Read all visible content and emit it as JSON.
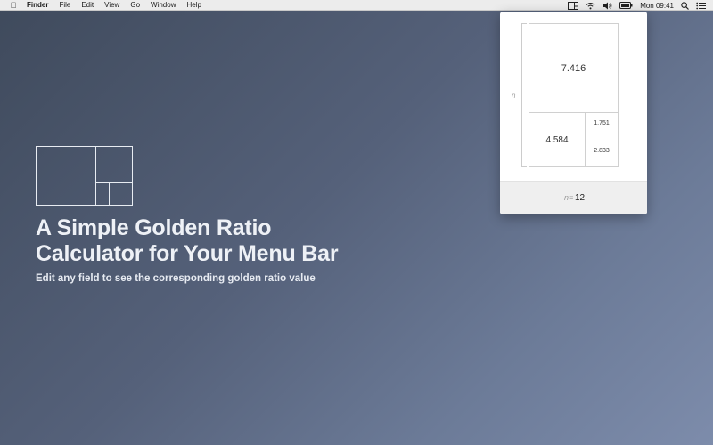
{
  "menubar": {
    "app_name": "Finder",
    "menus": [
      "File",
      "Edit",
      "View",
      "Go",
      "Window",
      "Help"
    ],
    "clock": "Mon 09:41",
    "status_icons": [
      "display-icon",
      "wifi-icon",
      "volume-icon",
      "battery-icon",
      "spotlight-icon",
      "notification-center-icon"
    ]
  },
  "hero": {
    "headline_line1": "A Simple Golden Ratio",
    "headline_line2": "Calculator for Your Menu Bar",
    "subline": "Edit any field to see the corresponding golden ratio value"
  },
  "popover": {
    "side_label": "n",
    "big_value": "7.416",
    "mid_value": "4.584",
    "small_top_value": "1.751",
    "small_bottom_value": "2.833",
    "input_label": "n=",
    "input_value": "12"
  },
  "colors": {
    "menubar_bg": "#ececec",
    "headline_text": "#eef1f6",
    "popover_bg": "#ffffff",
    "popover_footer_bg": "#efefef"
  }
}
